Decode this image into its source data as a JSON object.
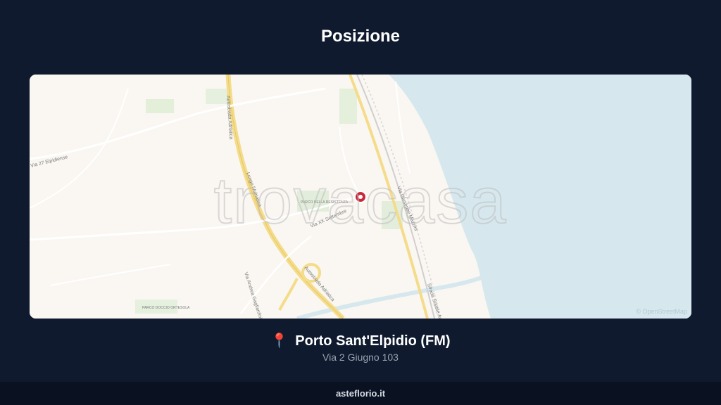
{
  "page": {
    "title": "Posizione"
  },
  "map": {
    "watermark": "trovacasa",
    "attribution": "© OpenStreetMap",
    "street_labels": {
      "via_xx_settembre": "Via XX Settembre",
      "via_giuseppe_mazzini": "Via Giuseppe Mazzini",
      "autostrada_adriatica_north": "Autostrada Adriatica",
      "autostrada_adriatica_south": "Autostrada Adriatica",
      "lungo_adriatica": "Lungo l'Adriatica",
      "via_andrea_gagliardini": "Via Andrea Gagliardini",
      "via_27_elpidiense": "Via 27 Elpidiense",
      "statale_adriatica": "Strada Statale Adriatica",
      "parco_resistenza": "PARCO DELLA RESISTENZA",
      "parco_ortesola": "PARCO DOCCIO ORTESOLA"
    },
    "marker_icon": "location-marker-icon",
    "colors": {
      "land": "#faf7f2",
      "sea": "#d6e8ee",
      "highway": "#f4dc8a",
      "marker": "#c8283a"
    }
  },
  "location": {
    "pin_icon": "pushpin-icon",
    "city": "Porto Sant'Elpidio (FM)",
    "address": "Via 2 Giugno 103"
  },
  "footer": {
    "site": "asteflorio.it"
  }
}
